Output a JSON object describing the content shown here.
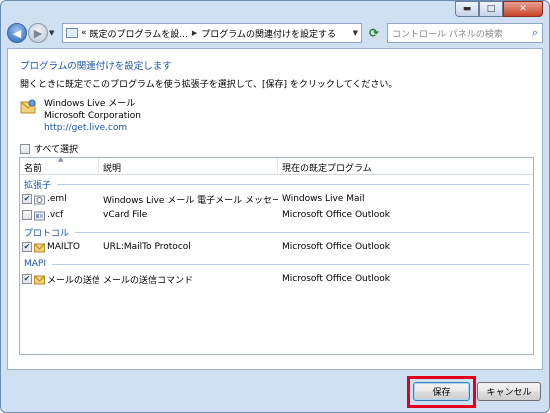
{
  "titlebar": {
    "minimize_icon": "minimize-icon",
    "maximize_icon": "maximize-icon",
    "close_icon": "close-icon"
  },
  "address_bar": {
    "overflow": "«",
    "crumbs": [
      "既定のプログラムを設...",
      "プログラムの関連付けを設定する"
    ],
    "search_placeholder": "コントロール パネルの検索"
  },
  "heading": "プログラムの関連付けを設定します",
  "instruction": "開くときに既定でこのプログラムを使う拡張子を選択して、[保存] をクリックしてください。",
  "app": {
    "name": "Windows Live メール",
    "company": "Microsoft Corporation",
    "url": "http://get.live.com"
  },
  "select_all_label": "すべて選択",
  "columns": {
    "name": "名前",
    "description": "説明",
    "current": "現在の既定プログラム"
  },
  "groups": [
    {
      "label": "拡張子",
      "rows": [
        {
          "checked": true,
          "name": ".eml",
          "description": "Windows Live メール 電子メール メッセージ",
          "current": "Windows Live Mail"
        },
        {
          "checked": false,
          "name": ".vcf",
          "description": "vCard File",
          "current": "Microsoft Office Outlook"
        }
      ]
    },
    {
      "label": "プロトコル",
      "rows": [
        {
          "checked": true,
          "name": "MAILTO",
          "description": "URL:MailTo Protocol",
          "current": "Microsoft Office Outlook"
        }
      ]
    },
    {
      "label": "MAPI",
      "rows": [
        {
          "checked": true,
          "name": "メールの送信",
          "description": "メールの送信コマンド",
          "current": "Microsoft Office Outlook"
        }
      ]
    }
  ],
  "buttons": {
    "save": "保存",
    "cancel": "キャンセル"
  },
  "colors": {
    "accent_text": "#1c57a8",
    "highlight_box": "#e2001a",
    "window_frame": "#cfe0f3"
  }
}
